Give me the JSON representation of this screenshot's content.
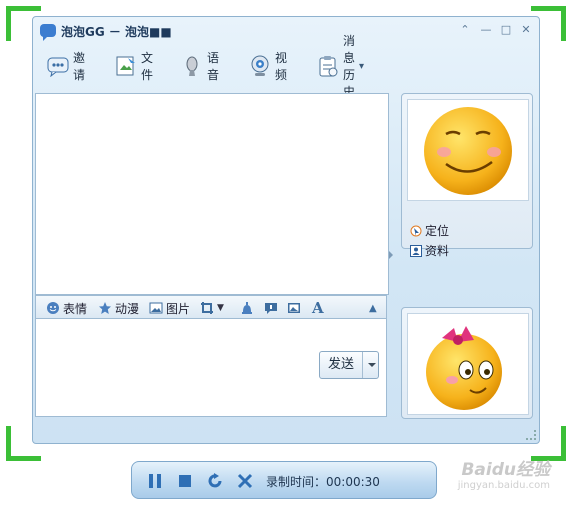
{
  "window": {
    "title": "泡泡GG － 泡泡■■",
    "controls": {
      "collapse": "⌃",
      "minimize": "—",
      "maximize": "□",
      "close": "✕"
    }
  },
  "toolbar": {
    "items": [
      {
        "label": "邀请",
        "icon": "invite-icon"
      },
      {
        "label": "文件",
        "icon": "file-icon"
      },
      {
        "label": "语音",
        "icon": "microphone-icon"
      },
      {
        "label": "视频",
        "icon": "webcam-icon"
      },
      {
        "label": "消息历史",
        "icon": "clipboard-icon"
      }
    ],
    "history_arrow": "▾"
  },
  "input_toolbar": {
    "emoji": "表情",
    "animation": "动漫",
    "picture": "图片",
    "font_glyph": "A",
    "collapse_arrow": "▲"
  },
  "send_button": {
    "label": "发送"
  },
  "profile_panel": {
    "locate": "定位",
    "profile": "资料"
  },
  "recorder": {
    "label": "录制时间：00:00:30",
    "elapsed": "00:00:30"
  },
  "watermark": {
    "logo": "Baidu经验",
    "url": "jingyan.baidu.com"
  },
  "colors": {
    "accent": "#3b7dd0",
    "corner_marks": "#3bbf37",
    "emoji_yellow": "#f6b21b"
  }
}
